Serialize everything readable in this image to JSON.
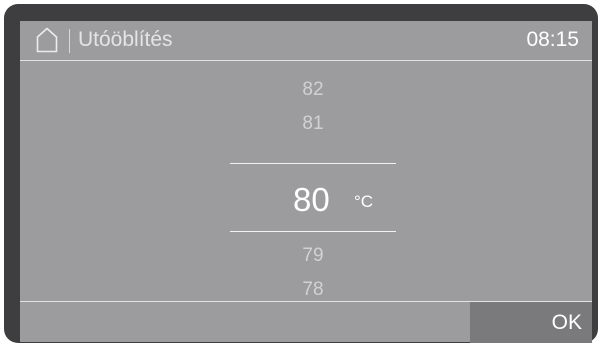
{
  "header": {
    "icon": "home-icon",
    "title": "Utóöblítés",
    "time": "08:15"
  },
  "picker": {
    "above": [
      "82",
      "81"
    ],
    "selected": "80",
    "unit": "°C",
    "below": [
      "79",
      "78"
    ]
  },
  "footer": {
    "ok_label": "OK"
  },
  "colors": {
    "screen": "#9c9c9e",
    "bezel": "#3e3e40",
    "ok_button": "#7a7a7c"
  }
}
